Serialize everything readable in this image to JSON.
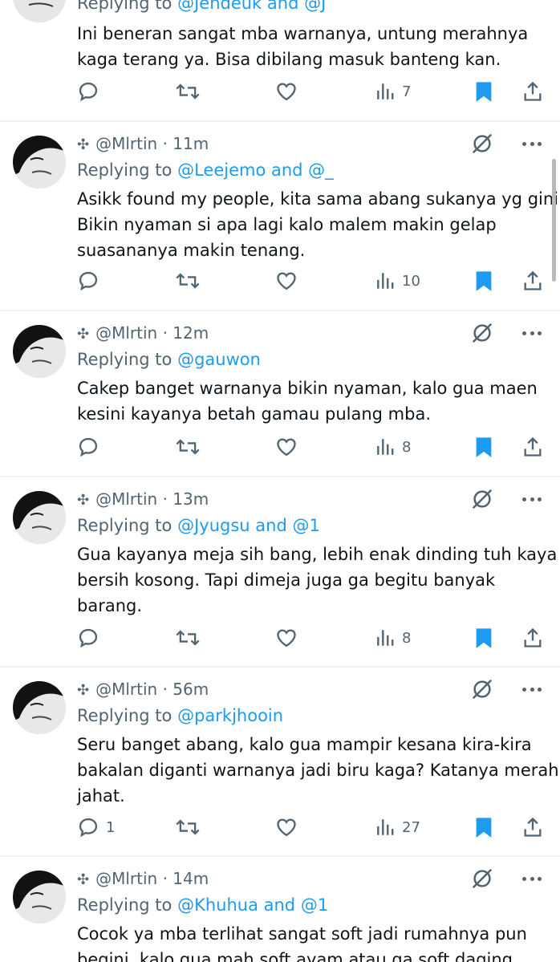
{
  "first_tweet": {
    "replying_prefix": "Replying to ",
    "replying_mentions": "@Jendeuk and @J",
    "lines": [
      "Ini beneran sangat mba warnanya, untung merahnya",
      "kaga terang ya. Bisa dibilang masuk banteng kan."
    ],
    "reply_count": "",
    "views": "7"
  },
  "tweets": [
    {
      "cross": "✣",
      "handle": "@Mlrtin",
      "time": "· 11m",
      "replying_prefix": "Replying to ",
      "replying_mentions": "@Leejemo and @_",
      "lines": [
        "Asikk found my people, kita sama abang sukanya yg gini.",
        "Bikin nyaman si apa lagi kalo malem makin gelap",
        "suasananya makin tenang."
      ],
      "reply_count": "",
      "views": "10"
    },
    {
      "cross": "✣",
      "handle": "@Mlrtin",
      "time": "· 12m",
      "replying_prefix": "Replying to ",
      "replying_mentions": "@gauwon",
      "lines": [
        "Cakep banget warnanya bikin nyaman, kalo gua maen",
        "kesini kayanya betah gamau pulang mba."
      ],
      "reply_count": "",
      "views": "8"
    },
    {
      "cross": "✣",
      "handle": "@Mlrtin",
      "time": "· 13m",
      "replying_prefix": "Replying to ",
      "replying_mentions": "@Jyugsu and @1",
      "lines": [
        "Gua kayanya meja sih bang, lebih enak dinding tuh kaya",
        "bersih kosong. Tapi dimeja juga ga begitu banyak",
        "barang."
      ],
      "reply_count": "",
      "views": "8"
    },
    {
      "cross": "✣",
      "handle": "@Mlrtin",
      "time": "· 56m",
      "replying_prefix": "Replying to ",
      "replying_mentions": "@parkjhooin",
      "lines": [
        "Seru banget abang, kalo gua mampir kesana kira-kira",
        "bakalan diganti warnanya jadi biru kaga? Katanya merah",
        "jahat."
      ],
      "reply_count": "1",
      "views": "27"
    },
    {
      "cross": "✣",
      "handle": "@Mlrtin",
      "time": "· 14m",
      "replying_prefix": "Replying to ",
      "replying_mentions": "@Khuhua and @1",
      "lines": [
        "Cocok ya mba terlihat sangat soft jadi rumahnya pun",
        "begini, kalo gua mah soft ayam atau ga soft daging"
      ],
      "reply_count": "",
      "views": ""
    }
  ],
  "icons": {
    "reply": "reply-icon",
    "retweet": "retweet-icon",
    "like": "like-icon",
    "views": "views-icon",
    "bookmark": "bookmark-icon",
    "share": "share-icon",
    "mute": "mute-icon",
    "more": "more-icon"
  },
  "colors": {
    "text": "#0f1419",
    "secondary": "#536471",
    "accent": "#1d9bf0",
    "divider": "#eff3f4"
  }
}
